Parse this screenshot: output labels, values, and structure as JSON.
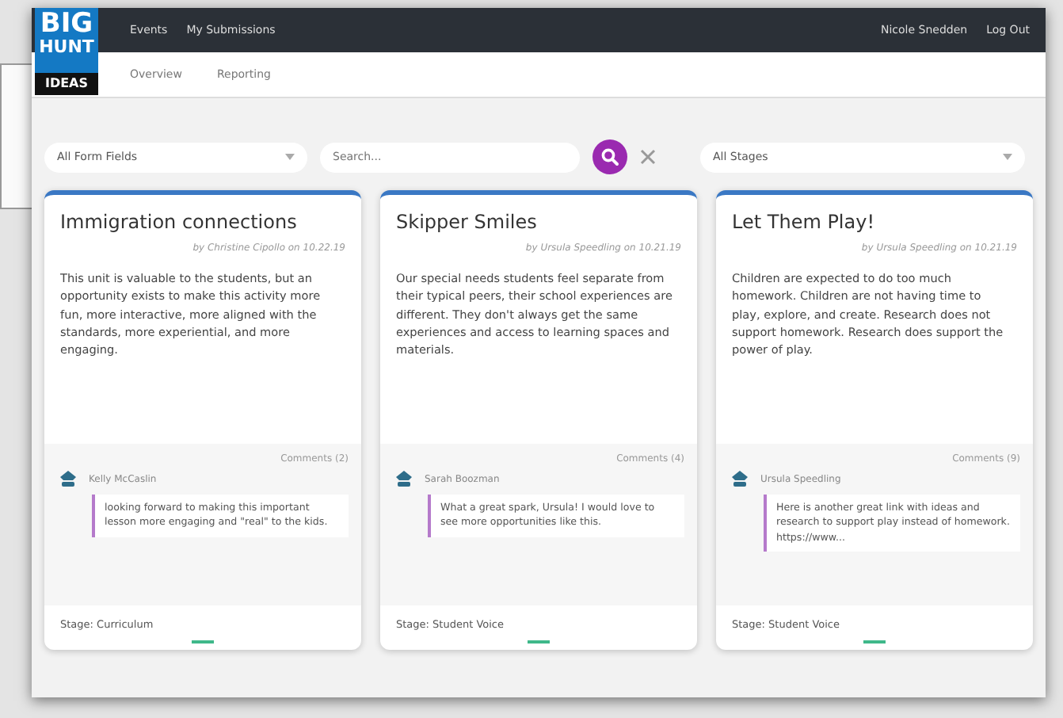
{
  "logo": {
    "lines": [
      "BIG",
      "HUNT",
      "IDEAS"
    ]
  },
  "nav": {
    "items": [
      "Events",
      "My Submissions"
    ],
    "user": "Nicole Snedden",
    "logout": "Log Out"
  },
  "subnav": {
    "items": [
      "Overview",
      "Reporting"
    ]
  },
  "filters": {
    "fields": "All Form Fields",
    "search_placeholder": "Search...",
    "stages": "All Stages"
  },
  "cards": [
    {
      "title": "Immigration connections",
      "byline": "by Christine Cipollo on 10.22.19",
      "body": "This unit is valuable to the students, but an opportunity exists to make this activity more fun, more interactive, more aligned with the standards, more experiential, and more engaging.",
      "comments_count": "Comments (2)",
      "commenter": "Kelly McCaslin",
      "comment": "looking forward to making this important lesson more engaging and \"real\" to the kids.",
      "stage": "Stage: Curriculum"
    },
    {
      "title": "Skipper Smiles",
      "byline": "by Ursula Speedling on 10.21.19",
      "body": "Our special needs students feel separate from their typical peers, their school experiences are different. They don't always get the same experiences and access to learning spaces and materials.",
      "comments_count": "Comments (4)",
      "commenter": "Sarah Boozman",
      "comment": "What a great spark, Ursula! I would love to see more opportunities like this.",
      "stage": "Stage: Student Voice"
    },
    {
      "title": "Let Them Play!",
      "byline": "by Ursula Speedling on 10.21.19",
      "body": "Children are expected to do too much homework. Children are not having time to play, explore, and create. Research does not support homework. Research does support the power of play.",
      "comments_count": "Comments (9)",
      "commenter": "Ursula Speedling",
      "comment": "Here is another great link with ideas and research to support play instead of homework. https://www...",
      "stage": "Stage: Student Voice"
    }
  ]
}
